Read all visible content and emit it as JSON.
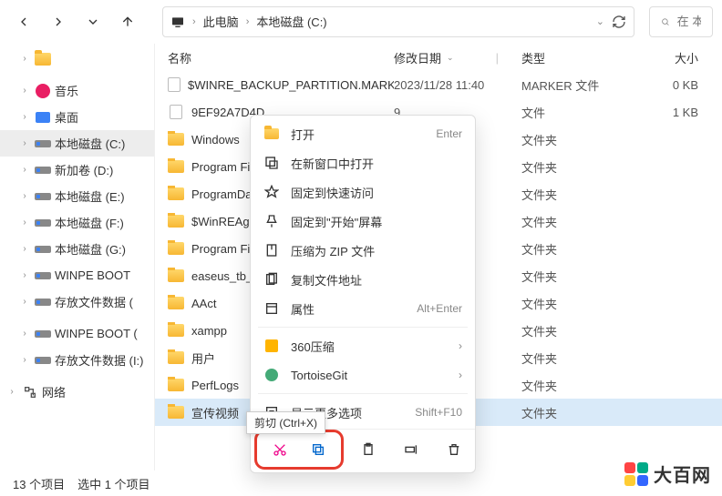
{
  "nav": {
    "refresh_aria": "刷新"
  },
  "breadcrumbs": {
    "pc": "此电脑",
    "drive": "本地磁盘 (C:)"
  },
  "search": {
    "placeholder": "在 本地"
  },
  "sidebar": {
    "items": [
      {
        "label": "",
        "icon": "folder",
        "indent": 1
      },
      {
        "label": "音乐",
        "icon": "music",
        "indent": 1
      },
      {
        "label": "桌面",
        "icon": "desktop",
        "indent": 1
      },
      {
        "label": "本地磁盘 (C:)",
        "icon": "disk",
        "indent": 1,
        "selected": true
      },
      {
        "label": "新加卷 (D:)",
        "icon": "disk",
        "indent": 1
      },
      {
        "label": "本地磁盘 (E:)",
        "icon": "disk",
        "indent": 1
      },
      {
        "label": "本地磁盘 (F:)",
        "icon": "disk",
        "indent": 1
      },
      {
        "label": "本地磁盘 (G:)",
        "icon": "disk",
        "indent": 1
      },
      {
        "label": "WINPE BOOT",
        "icon": "disk",
        "indent": 1
      },
      {
        "label": "存放文件数据 (",
        "icon": "disk",
        "indent": 1
      },
      {
        "label": "WINPE BOOT (",
        "icon": "disk",
        "indent": 1
      },
      {
        "label": "存放文件数据 (I:)",
        "icon": "disk",
        "indent": 1
      },
      {
        "label": "网络",
        "icon": "network",
        "indent": 0
      }
    ]
  },
  "headers": {
    "name": "名称",
    "date": "修改日期",
    "type": "类型",
    "size": "大小"
  },
  "rows": [
    {
      "name": "$WINRE_BACKUP_PARTITION.MARKER",
      "date": "2023/11/28 11:40",
      "type": "MARKER 文件",
      "size": "0 KB",
      "icon": "file"
    },
    {
      "name": "9EF92A7D4D",
      "date": "9",
      "type": "文件",
      "size": "1 KB",
      "icon": "file"
    },
    {
      "name": "Windows",
      "date": "",
      "type": "文件夹",
      "size": "",
      "icon": "folder"
    },
    {
      "name": "Program File",
      "date": "",
      "type": "文件夹",
      "size": "",
      "icon": "folder"
    },
    {
      "name": "ProgramData",
      "date": "",
      "type": "文件夹",
      "size": "",
      "icon": "folder"
    },
    {
      "name": "$WinREAgent",
      "date": "40",
      "type": "文件夹",
      "size": "",
      "icon": "folder"
    },
    {
      "name": "Program File",
      "date": "",
      "type": "文件夹",
      "size": "",
      "icon": "folder"
    },
    {
      "name": "easeus_tb_cl",
      "date": "",
      "type": "文件夹",
      "size": "",
      "icon": "folder"
    },
    {
      "name": "AAct",
      "date": "",
      "type": "文件夹",
      "size": "",
      "icon": "folder"
    },
    {
      "name": "xampp",
      "date": "",
      "type": "文件夹",
      "size": "",
      "icon": "folder"
    },
    {
      "name": "用户",
      "date": "",
      "type": "文件夹",
      "size": "",
      "icon": "folder"
    },
    {
      "name": "PerfLogs",
      "date": "",
      "type": "文件夹",
      "size": "",
      "icon": "folder"
    },
    {
      "name": "宣传视频",
      "date": "",
      "type": "文件夹",
      "size": "",
      "icon": "folder",
      "selected": true
    }
  ],
  "ctx": {
    "items": [
      {
        "label": "打开",
        "accel": "Enter",
        "icon": "open"
      },
      {
        "label": "在新窗口中打开",
        "accel": "",
        "icon": "newwin"
      },
      {
        "label": "固定到快速访问",
        "accel": "",
        "icon": "pin"
      },
      {
        "label": "固定到\"开始\"屏幕",
        "accel": "",
        "icon": "pinstart"
      },
      {
        "label": "压缩为 ZIP 文件",
        "accel": "",
        "icon": "zip"
      },
      {
        "label": "复制文件地址",
        "accel": "",
        "icon": "copypath"
      },
      {
        "label": "属性",
        "accel": "Alt+Enter",
        "icon": "props"
      },
      {
        "label": "360压缩",
        "accel": "",
        "icon": "360",
        "submenu": true
      },
      {
        "label": "TortoiseGit",
        "accel": "",
        "icon": "tortoise",
        "submenu": true
      },
      {
        "label": "显示更多选项",
        "accel": "Shift+F10",
        "icon": "more"
      }
    ]
  },
  "tooltip": "剪切 (Ctrl+X)",
  "status": {
    "count": "13 个项目",
    "selected": "选中 1 个项目"
  },
  "watermark": "大百网"
}
